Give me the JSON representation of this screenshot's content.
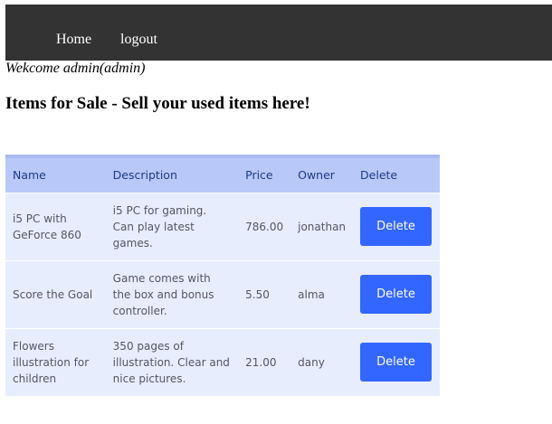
{
  "nav": {
    "home_label": "Home",
    "logout_label": "logout"
  },
  "welcome_text": "Wekcome admin(admin)",
  "page_title": "Items for Sale - Sell your used items here!",
  "table": {
    "headers": {
      "name": "Name",
      "description": "Description",
      "price": "Price",
      "owner": "Owner",
      "delete": "Delete"
    },
    "rows": [
      {
        "name": "i5 PC with GeForce 860",
        "description": "i5 PC for gaming. Can play latest games.",
        "price": "786.00",
        "owner": "jonathan",
        "delete_label": "Delete"
      },
      {
        "name": "Score the Goal",
        "description": "Game comes with the box and bonus controller.",
        "price": "5.50",
        "owner": "alma",
        "delete_label": "Delete"
      },
      {
        "name": "Flowers illustration for children",
        "description": "350 pages of illustration. Clear and nice pictures.",
        "price": "21.00",
        "owner": "dany",
        "delete_label": "Delete"
      }
    ]
  },
  "colors": {
    "navbar": "#333333",
    "table_header": "#b8c8f8",
    "table_row": "#e8edfd",
    "delete_button": "#3366ff"
  }
}
